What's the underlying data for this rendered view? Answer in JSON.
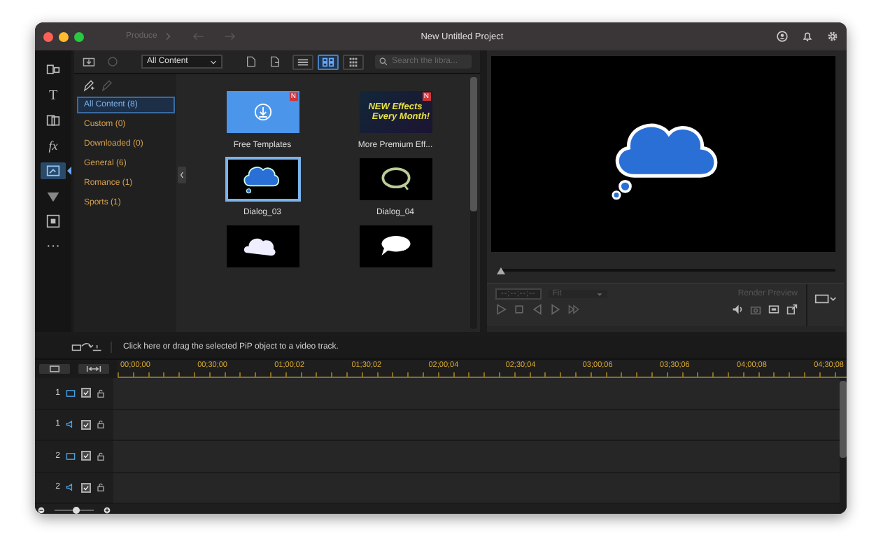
{
  "window": {
    "title": "New Untitled Project",
    "nav": "Produce"
  },
  "toolbar": {
    "content_filter": "All Content",
    "search": {
      "placeholder": "Search the libra..."
    },
    "view_buttons": [
      {
        "kind": "list",
        "selected": false
      },
      {
        "kind": "grid",
        "selected": true
      },
      {
        "kind": "small_grid",
        "selected": false
      }
    ]
  },
  "categories": [
    {
      "label": "All Content (8)",
      "selected": true
    },
    {
      "label": "Custom (0)",
      "selected": false
    },
    {
      "label": "Downloaded (0)",
      "selected": false
    },
    {
      "label": "General (6)",
      "selected": false
    },
    {
      "label": "Romance (1)",
      "selected": false
    },
    {
      "label": "Sports (1)",
      "selected": false
    }
  ],
  "sidebar": {
    "items": [
      {
        "kind": "media",
        "selected": false
      },
      {
        "kind": "title",
        "label": "T",
        "selected": false
      },
      {
        "kind": "transition",
        "selected": false
      },
      {
        "kind": "fx",
        "label": "fx",
        "selected": false
      },
      {
        "kind": "pip",
        "selected": true
      },
      {
        "kind": "particle",
        "selected": false
      },
      {
        "kind": "frame",
        "selected": false
      },
      {
        "kind": "more",
        "label": "···",
        "selected": false
      }
    ]
  },
  "thumbnails": [
    {
      "kind": "download",
      "label": "Free Templates",
      "badge": "N",
      "selected": false
    },
    {
      "kind": "promo",
      "label": "More Premium Eff...",
      "badge": "N",
      "promo_lines": [
        "NEW Effects",
        "Every Month!"
      ],
      "selected": false
    },
    {
      "kind": "cloud",
      "label": "Dialog_03",
      "selected": true
    },
    {
      "kind": "ring",
      "label": "Dialog_04",
      "selected": false
    },
    {
      "kind": "puff",
      "selected": false
    },
    {
      "kind": "oval",
      "selected": false
    }
  ],
  "preview": {
    "timecode": "--;--;--;--",
    "fit": "Fit",
    "render_button": {
      "label": "Render Preview",
      "disabled": true
    },
    "slider": {
      "level": 0
    }
  },
  "timeline": {
    "hint": "Click here or drag the selected PiP object to a video track.",
    "ruler": [
      "00;00;00",
      "00;30;00",
      "01;00;02",
      "01;30;02",
      "02;00;04",
      "02;30;04",
      "03;00;06",
      "03;30;06",
      "04;00;08",
      "04;30;08"
    ],
    "tracks": [
      {
        "number": "1",
        "kind": "video",
        "checked": true
      },
      {
        "number": "1",
        "kind": "audio",
        "checked": true
      },
      {
        "number": "2",
        "kind": "video",
        "checked": true
      },
      {
        "number": "2",
        "kind": "audio",
        "checked": true
      }
    ],
    "zoom": {
      "level": 0.55
    }
  }
}
